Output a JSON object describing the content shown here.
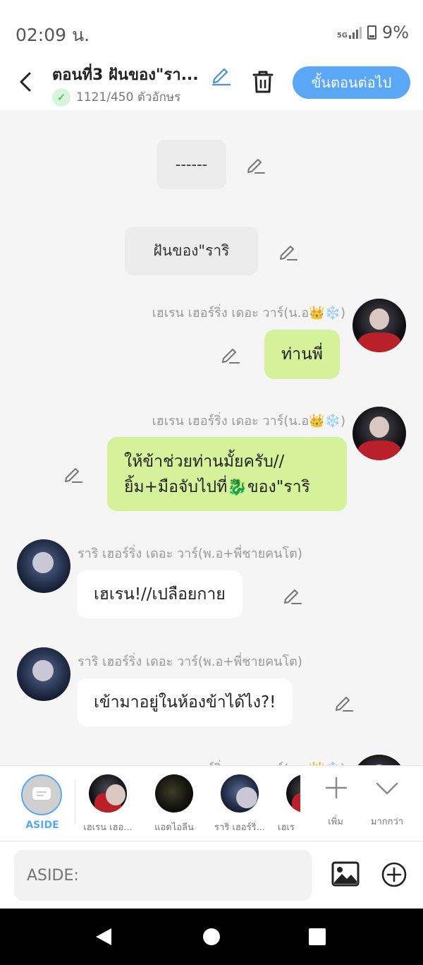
{
  "status": {
    "time": "02:09 น.",
    "network": "5G",
    "battery": "9%"
  },
  "header": {
    "title": "ตอนที่3 ฝันของ\"รา...",
    "word_count": "1121/450 ตัวอักษร",
    "next_label": "ขั้นตอนต่อไป"
  },
  "messages": [
    {
      "type": "narration",
      "text": "------"
    },
    {
      "type": "narration",
      "text": "ฝันของ\"ราริ"
    },
    {
      "type": "right",
      "name": "เฮเรน เฮอร์ริ่ง เดอะ วาร์(น.อ👑❄️)",
      "text": "ท่านพี่"
    },
    {
      "type": "right",
      "name": "เฮเรน เฮอร์ริ่ง เดอะ วาร์(น.อ👑❄️)",
      "line1": "ให้ข้าช่วยท่านมั้ยครับ//",
      "line2": "ยิ้ม+มือจับไปที่🐉ของ\"ราริ"
    },
    {
      "type": "left",
      "name": "ราริ เฮอร์ริ่ง เดอะ วาร์(พ.อ+พี่ชายคนโต)",
      "text": "เฮเรน!//เปลือยกาย"
    },
    {
      "type": "left",
      "name": "ราริ เฮอร์ริ่ง เดอะ วาร์(พ.อ+พี่ชายคนโต)",
      "text": "เข้ามาอยู่ในห้องข้าได้ไง?!"
    },
    {
      "type": "right",
      "name": "เฮเรน เฮอร์ริ่ง เดอะ วาร์(น.อ👑❄️)"
    }
  ],
  "characters": {
    "aside": "ASIDE",
    "list": [
      "เฮเรน เฮอ...",
      "แอดไอลีน",
      "ราริ เฮอร์ริ่...",
      "เฮเร"
    ],
    "add_label": "เพิ่ม",
    "more_label": "มากกว่า"
  },
  "input": {
    "placeholder": "ASIDE:"
  },
  "colors": {
    "accent": "#5aa7f5",
    "green_bubble": "#d5f29a",
    "narration_bg": "#ececec"
  }
}
